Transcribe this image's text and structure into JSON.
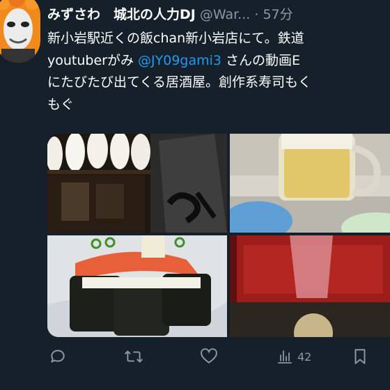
{
  "tweet": {
    "display_name": "みずさわ　城北の人力DJ",
    "handle": "@War...",
    "separator": "·",
    "time": "57分",
    "text_line1": "新小岩駅近くの飯chan新小岩店にて。鉄道",
    "text_line2_before": "youtuberがみ ",
    "mention": "@JY09gami3",
    "text_line2_after": " さんの動画E",
    "text_line3": "にたびたび出てくる居酒屋。創作系寿司もく",
    "text_line4": "もぐ"
  },
  "media": {
    "photos": [
      {
        "name": "photo-izakaya-interior"
      },
      {
        "name": "photo-beer-mug"
      },
      {
        "name": "photo-salmon-sushi"
      },
      {
        "name": "photo-sake-masu"
      }
    ]
  },
  "actions": {
    "reply_icon": "reply-icon",
    "retweet_icon": "retweet-icon",
    "like_icon": "heart-icon",
    "views_icon": "views-icon",
    "views_count": "42",
    "bookmark_icon": "bookmark-icon"
  },
  "colors": {
    "background": "#15202b",
    "text": "#ffffff",
    "secondary": "#8b98a5",
    "link": "#1d9bf0"
  }
}
